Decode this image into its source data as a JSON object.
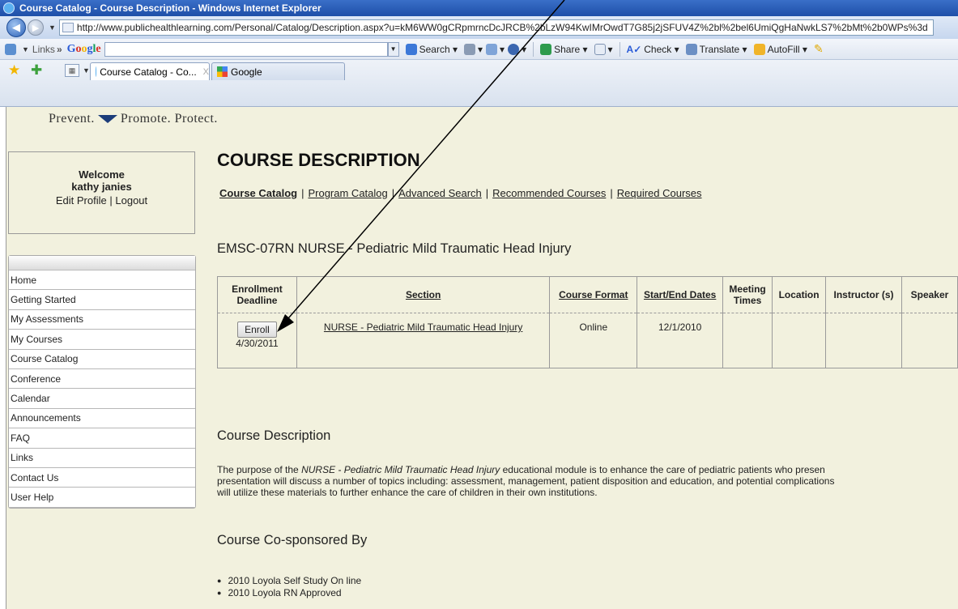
{
  "window": {
    "title": "Course Catalog - Course Description - Windows Internet Explorer"
  },
  "address": {
    "url": "http://www.publichealthlearning.com/Personal/Catalog/Description.aspx?u=kM6WW0gCRpmrncDcJRCB%2bLzW94KwIMrOwdT7G85j2jSFUV4Z%2bl%2bel6UmiQgHaNwkLS7%2bMt%2b0WPs%3d"
  },
  "toolbar": {
    "links_label": "Links",
    "google_label": "Google",
    "search_label": "Search",
    "share_label": "Share",
    "check_label": "Check",
    "translate_label": "Translate",
    "autofill_label": "AutoFill"
  },
  "tabs": [
    {
      "label": "Course Catalog - Co..."
    },
    {
      "label": "Google"
    }
  ],
  "site": {
    "tagline_left": "Prevent.",
    "tagline_right": "Promote. Protect."
  },
  "welcome": {
    "line1": "Welcome",
    "user": "kathy janies",
    "edit_profile": "Edit Profile",
    "sep": "|",
    "logout": "Logout"
  },
  "sidebar": {
    "items": [
      {
        "label": "Home"
      },
      {
        "label": "Getting Started"
      },
      {
        "label": "My Assessments"
      },
      {
        "label": "My Courses"
      },
      {
        "label": "Course Catalog"
      },
      {
        "label": "Conference"
      },
      {
        "label": "Calendar"
      },
      {
        "label": "Announcements"
      },
      {
        "label": "FAQ"
      },
      {
        "label": "Links"
      },
      {
        "label": "Contact Us"
      },
      {
        "label": "User Help"
      }
    ]
  },
  "main": {
    "heading": "COURSE DESCRIPTION",
    "subnav": [
      {
        "label": "Course Catalog"
      },
      {
        "label": "Program Catalog"
      },
      {
        "label": "Advanced Search"
      },
      {
        "label": "Recommended Courses"
      },
      {
        "label": "Required Courses"
      }
    ],
    "course_title": "EMSC-07RN NURSE - Pediatric Mild Traumatic Head Injury",
    "table": {
      "headers": [
        "Enrollment Deadline",
        "Section",
        "Course Format",
        "Start/End Dates",
        "Meeting Times",
        "Location",
        "Instructor (s)",
        "Speaker"
      ],
      "row": {
        "enroll_label": "Enroll",
        "deadline": "4/30/2011",
        "section": "NURSE - Pediatric Mild Traumatic Head Injury",
        "format": "Online",
        "dates": "12/1/2010",
        "meeting": "",
        "location": "",
        "instructor": "",
        "speaker": ""
      }
    },
    "description_heading": "Course Description",
    "description_pre": "The purpose of the ",
    "description_em": "NURSE - Pediatric Mild Traumatic Head Injury",
    "description_post": " educational module is to enhance the care of pediatric patients who presen",
    "description_line2": "presentation will discuss a number of topics including: assessment, management, patient disposition and education, and potential complications",
    "description_line3": "will utilize these materials to further enhance the care of children in their own institutions.",
    "cosponsor_heading": "Course Co-sponsored By",
    "cosponsors": [
      "2010 Loyola Self Study On line",
      "2010 Loyola RN Approved"
    ]
  }
}
